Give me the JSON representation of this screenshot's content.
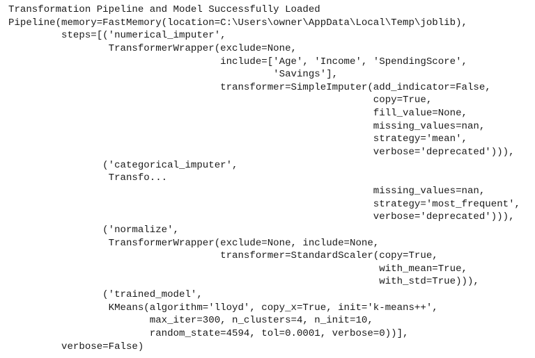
{
  "output": {
    "status_message": "Transformation Pipeline and Model Successfully Loaded",
    "lines": [
      "Pipeline(memory=FastMemory(location=C:\\Users\\owner\\AppData\\Local\\Temp\\joblib),",
      "         steps=[('numerical_imputer',",
      "                 TransformerWrapper(exclude=None,",
      "                                    include=['Age', 'Income', 'SpendingScore',",
      "                                             'Savings'],",
      "                                    transformer=SimpleImputer(add_indicator=False,",
      "                                                              copy=True,",
      "                                                              fill_value=None,",
      "                                                              missing_values=nan,",
      "                                                              strategy='mean',",
      "                                                              verbose='deprecated'))),",
      "                ('categorical_imputer',",
      "                 Transfo...",
      "                                                              missing_values=nan,",
      "                                                              strategy='most_frequent',",
      "                                                              verbose='deprecated'))),",
      "                ('normalize',",
      "                 TransformerWrapper(exclude=None, include=None,",
      "                                    transformer=StandardScaler(copy=True,",
      "                                                               with_mean=True,",
      "                                                               with_std=True))),",
      "                ('trained_model',",
      "                 KMeans(algorithm='lloyd', copy_x=True, init='k-means++',",
      "                        max_iter=300, n_clusters=4, n_init=10,",
      "                        random_state=4594, tol=0.0001, verbose=0))],",
      "         verbose=False)"
    ]
  }
}
